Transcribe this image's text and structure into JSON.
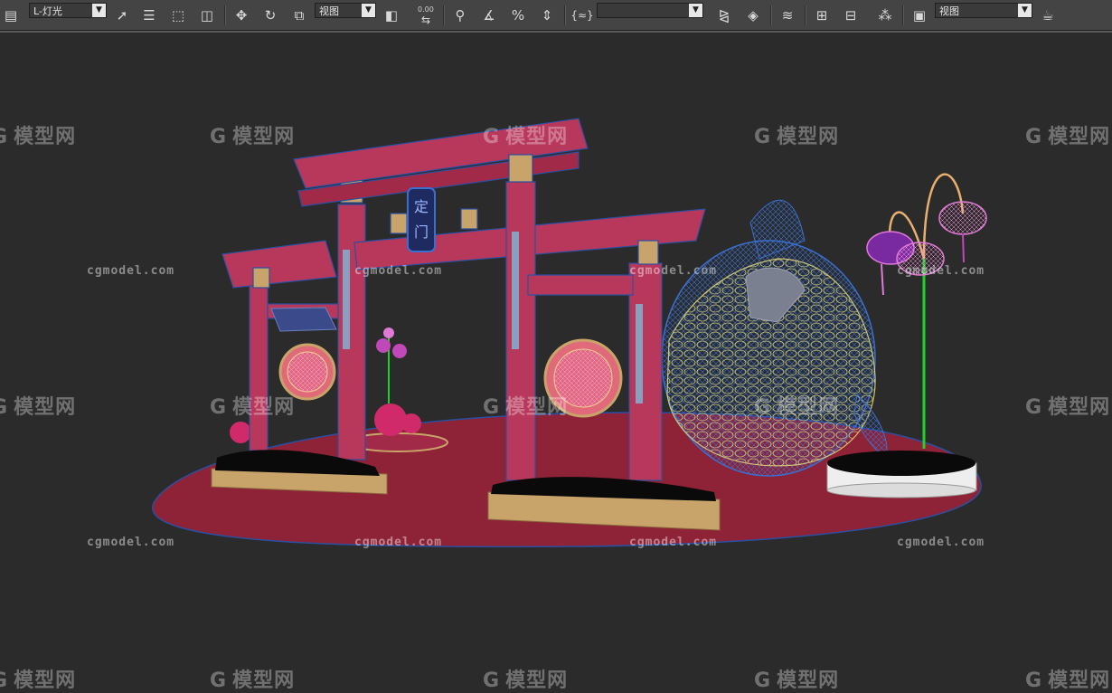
{
  "toolbar": {
    "selection_filter": "L-灯光",
    "ref_coord_1": "视图",
    "spinner_value": "0.00",
    "named_selection": "",
    "ref_coord_2": "视图",
    "curly_label": "{≈}"
  },
  "icons": {
    "app": "layers-app-icon",
    "select": "select-arrow-icon",
    "select_by_name": "select-by-name-icon",
    "rect_region": "rectangle-region-icon",
    "window_crossing": "window-crossing-icon",
    "move": "move-icon",
    "rotate": "rotate-icon",
    "scale": "scale-icon",
    "pivot": "pivot-icon",
    "snap_toggle": "snap-toggle-icon",
    "angle_snap": "angle-snap-icon",
    "percent_snap": "percent-snap-icon",
    "spinner_snap": "spinner-snap-icon",
    "mirror": "mirror-icon",
    "align": "align-icon",
    "layer_manager": "layer-manager-icon",
    "curve_editor": "curve-editor-icon",
    "schematic": "schematic-view-icon",
    "material_editor": "material-editor-icon",
    "render_setup": "render-setup-icon",
    "render": "render-teapot-icon"
  },
  "watermark": {
    "brand_cn": "模型网",
    "brand_en": "cgmodel.com"
  },
  "scene": {
    "sign_text": [
      "定",
      "门"
    ],
    "background": "#2b2b2b",
    "colors": {
      "ground": "#8e2236",
      "gate_red": "#b8385c",
      "gate_outline": "#2b4fa0",
      "gold": "#c9a46a",
      "wire_yellow": "#d9d27a",
      "wire_blue": "#3a6fd0",
      "lamp_purple": "#c048b8",
      "stem_green": "#22d02a"
    }
  }
}
